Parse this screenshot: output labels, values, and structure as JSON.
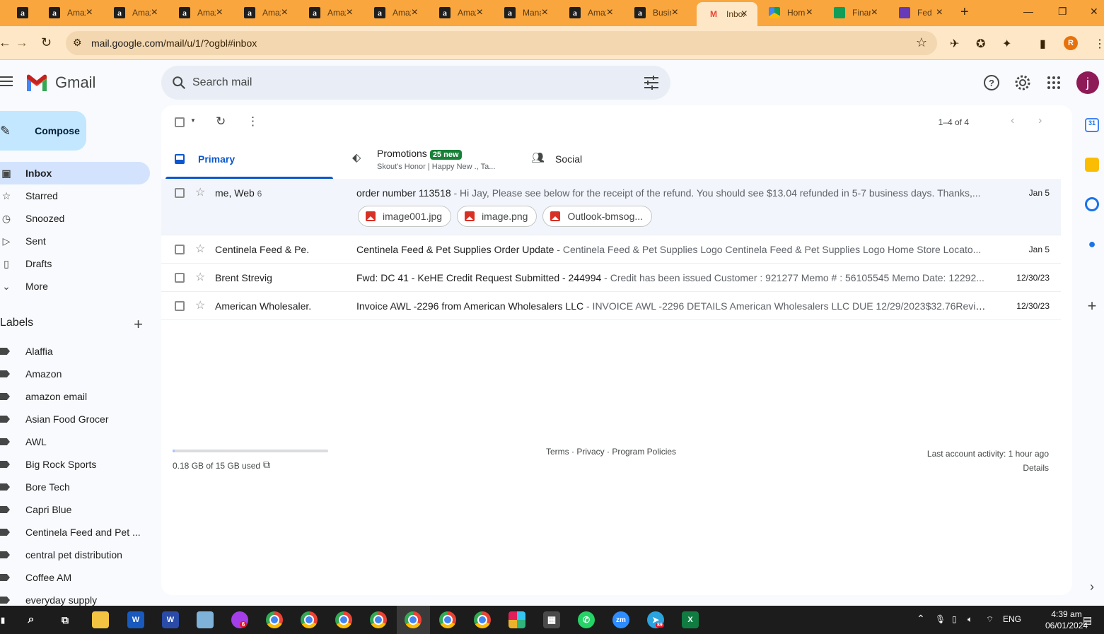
{
  "browser": {
    "tabs": [
      {
        "title": "",
        "icon": "amazon-icon"
      },
      {
        "title": "Amazon",
        "icon": "amazon-icon"
      },
      {
        "title": "Amazon",
        "icon": "amazon-icon"
      },
      {
        "title": "Amazon",
        "icon": "amazon-icon"
      },
      {
        "title": "Amazon",
        "icon": "amazon-icon"
      },
      {
        "title": "Amazon",
        "icon": "amazon-icon"
      },
      {
        "title": "Amazon",
        "icon": "amazon-icon"
      },
      {
        "title": "Amazon",
        "icon": "amazon-icon"
      },
      {
        "title": "Manage",
        "icon": "amazon-icon"
      },
      {
        "title": "Amazon",
        "icon": "amazon-icon"
      },
      {
        "title": "Business",
        "icon": "amazon-icon"
      },
      {
        "title": "Inbox",
        "icon": "gmail-icon",
        "active": true
      },
      {
        "title": "Home",
        "icon": "drive-icon"
      },
      {
        "title": "Finance",
        "icon": "sheets-icon"
      },
      {
        "title": "Fed",
        "icon": "forms-icon"
      }
    ],
    "url_host": "mail.google.com",
    "url_path": "/mail/u/1/?ogbl#inbox",
    "profile_initial": "R",
    "accent": "#f9a63f"
  },
  "gmail": {
    "logo_text": "Gmail",
    "search_placeholder": "Search mail",
    "avatar_initial": "j",
    "compose_label": "Compose",
    "nav": [
      {
        "label": "Inbox",
        "icon": "inbox-icon",
        "active": true
      },
      {
        "label": "Starred",
        "icon": "star-icon"
      },
      {
        "label": "Snoozed",
        "icon": "clock-icon"
      },
      {
        "label": "Sent",
        "icon": "send-icon"
      },
      {
        "label": "Drafts",
        "icon": "draft-icon"
      },
      {
        "label": "More",
        "icon": "chevron-down-icon"
      }
    ],
    "labels_title": "Labels",
    "labels": [
      "Alaffia",
      "Amazon",
      "amazon email",
      "Asian Food Grocer",
      "AWL",
      "Big Rock Sports",
      "Bore Tech",
      "Capri Blue",
      "Centinela Feed and Pet ...",
      "central pet distribution",
      "Coffee AM",
      "everyday supply"
    ],
    "pager": "1–4 of 4",
    "tabs": {
      "primary": "Primary",
      "promotions": "Promotions",
      "promotions_badge": "25 new",
      "promotions_sub": "Skout's Honor | Happy New ., Ta...",
      "social": "Social"
    },
    "emails": [
      {
        "from": "me, Web",
        "count": "6",
        "subject": "order number 113518",
        "snippet": " - Hi Jay, Please see below for the receipt of the refund. You should see $13.04 refunded in 5-7 business days. Thanks,...",
        "date": "Jan 5",
        "attachments": [
          "image001.jpg",
          "image.png",
          "Outlook-bmsog..."
        ]
      },
      {
        "from": "Centinela Feed & Pe.",
        "subject": "Centinela Feed & Pet Supplies Order Update",
        "snippet": " - Centinela Feed & Pet Supplies Logo Centinela Feed & Pet Supplies Logo Home Store Locato...",
        "date": "Jan 5"
      },
      {
        "from": "Brent Strevig",
        "subject": "Fwd: DC 41 - KeHE Credit Request Submitted - 244994",
        "snippet": " - Credit has been issued Customer : 921277 Memo # : 56105545 Memo Date: 12292...",
        "date": "12/30/23"
      },
      {
        "from": "American Wholesaler.",
        "subject": "Invoice AWL -2296 from American Wholesalers LLC",
        "snippet": " - INVOICE AWL -2296 DETAILS American Wholesalers LLC DUE 12/29/2023$32.76Revie...",
        "date": "12/30/23"
      }
    ],
    "footer": {
      "storage": "0.18 GB of 15 GB used",
      "storage_fraction": 0.012,
      "links": "Terms · Privacy · Program Policies",
      "activity": "Last account activity: 1 hour ago",
      "details": "Details"
    }
  },
  "taskbar": {
    "lang": "ENG",
    "time": "4:39 am",
    "date": "06/01/2024",
    "messenger_badge": "6",
    "telegram_badge": "89"
  }
}
